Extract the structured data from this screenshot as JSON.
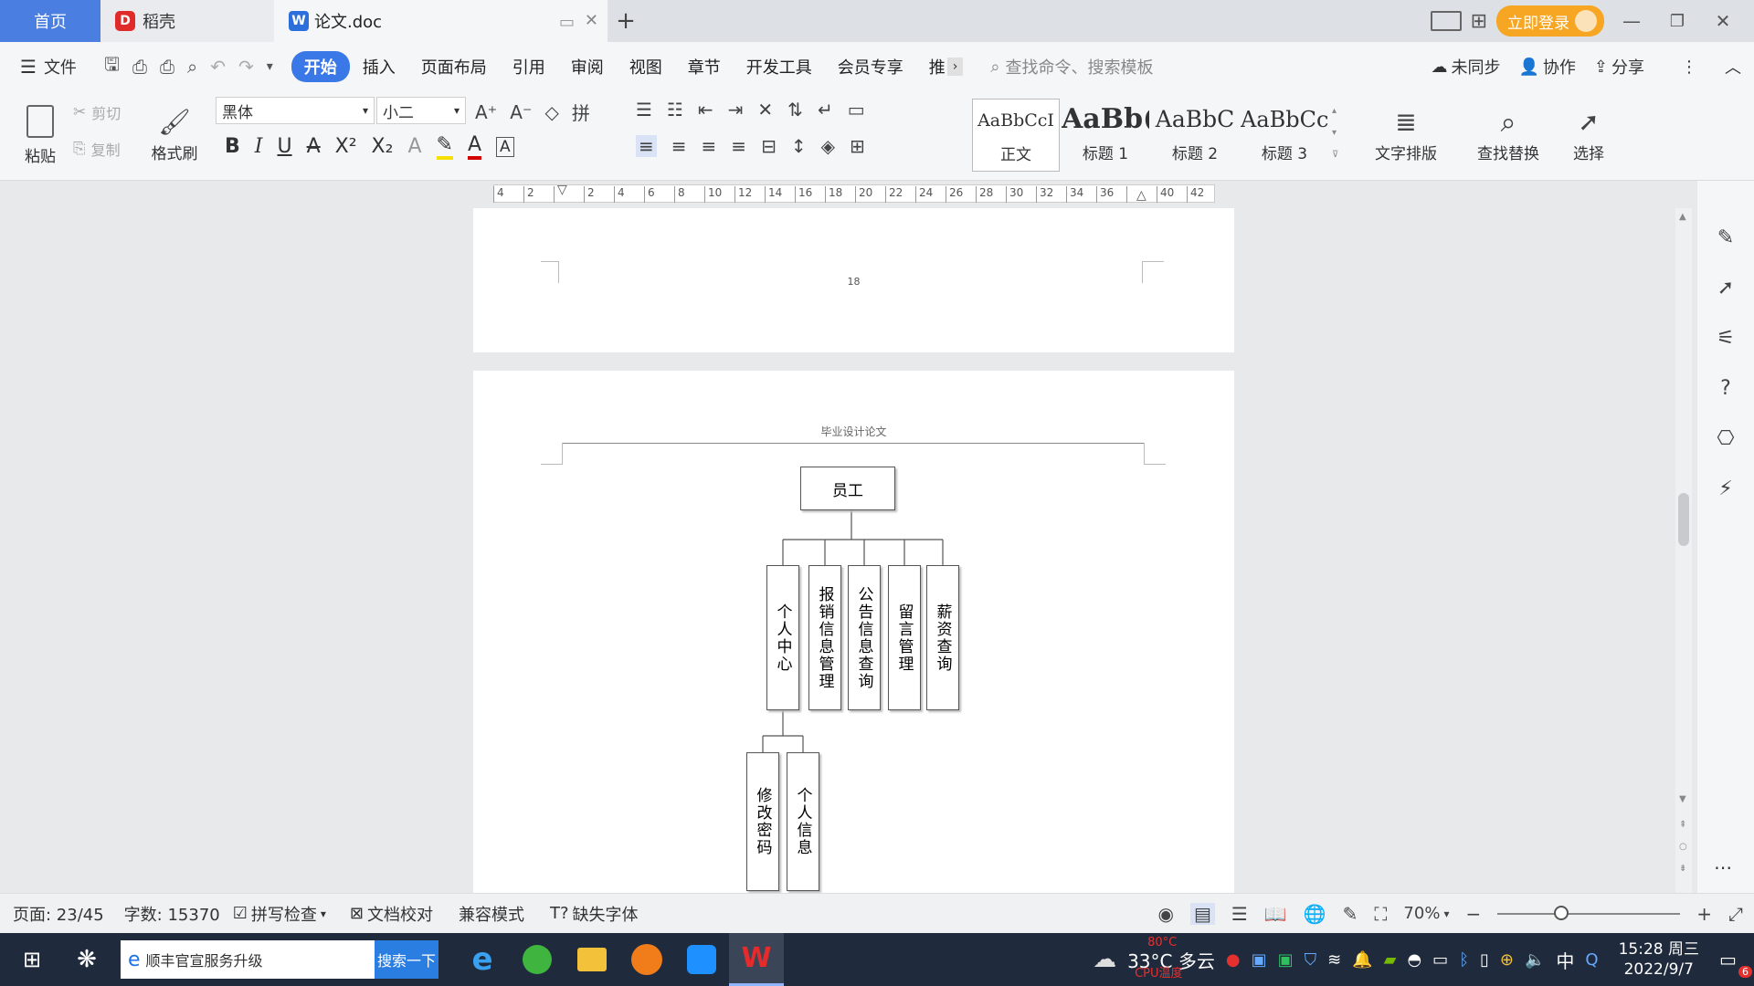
{
  "tabs": {
    "home": "首页",
    "wps": "稻壳",
    "doc": "论文.doc"
  },
  "titlebar": {
    "login": "立即登录"
  },
  "menu": {
    "file": "文件",
    "items": [
      "开始",
      "插入",
      "页面布局",
      "引用",
      "审阅",
      "视图",
      "章节",
      "开发工具",
      "会员专享",
      "推"
    ],
    "search_placeholder": "查找命令、搜索模板",
    "sync": "未同步",
    "collab": "协作",
    "share": "分享"
  },
  "ribbon": {
    "paste": "粘贴",
    "cut": "剪切",
    "copy": "复制",
    "format_painter": "格式刷",
    "font": "黑体",
    "size": "小二",
    "styles": [
      {
        "preview": "AaBbCcI",
        "name": "正文"
      },
      {
        "preview": "AaBb(",
        "name": "标题 1"
      },
      {
        "preview": "AaBbC",
        "name": "标题 2"
      },
      {
        "preview": "AaBbCc",
        "name": "标题 3"
      }
    ],
    "text_layout": "文字排版",
    "find_replace": "查找替换",
    "select": "选择"
  },
  "ruler": {
    "ticks": [
      "4",
      "2",
      "",
      "2",
      "4",
      "6",
      "8",
      "10",
      "12",
      "14",
      "16",
      "18",
      "20",
      "22",
      "24",
      "26",
      "28",
      "30",
      "32",
      "34",
      "36",
      "",
      "40",
      "42"
    ]
  },
  "page1": {
    "page_number": "18"
  },
  "page2": {
    "header": "毕业设计论文",
    "org": {
      "root": "员工",
      "children": [
        "个人中心",
        "报销信息管理",
        "公告信息查询",
        "留言管理",
        "薪资查询"
      ],
      "sub": [
        "修改密码",
        "个人信息"
      ]
    }
  },
  "status": {
    "page": "页面: 23/45",
    "words": "字数: 15370",
    "spell": "拼写检查",
    "proof": "文档校对",
    "compat": "兼容模式",
    "missing_font": "缺失字体",
    "zoom": "70%"
  },
  "taskbar": {
    "search_text": "顺丰官宣服务升级",
    "search_btn": "搜索一下",
    "weather": "33°C 多云",
    "cpu_temp": "80°C",
    "cpu_label": "CPU温度",
    "ime": "中",
    "time": "15:28 周三",
    "date": "2022/9/7",
    "notif": "6"
  }
}
